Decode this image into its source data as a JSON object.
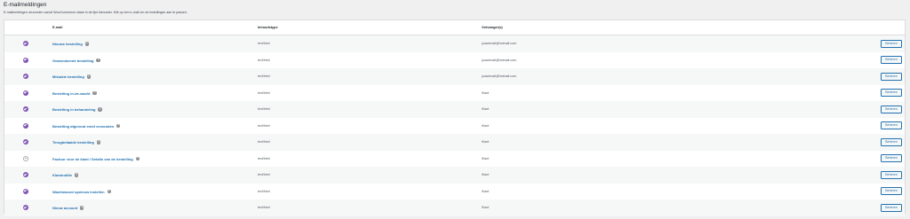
{
  "header": {
    "title": "E-mailmeldingen",
    "description": "E-mailmeldingen verzonden vanuit WooCommerce staan in de lijst hieronder. Klik op een e-mail om de instellingen aan te passen."
  },
  "table": {
    "columns": {
      "email": "E-mail",
      "content_type": "Inhoudstype",
      "recipients": "Ontvanger(s)"
    },
    "rows": [
      {
        "enabled": true,
        "name": "Nieuwe bestelling",
        "content_type": "text/html",
        "recipient": "jouwemail@hotmail.com",
        "action": "Beheren"
      },
      {
        "enabled": true,
        "name": "Geannuleerde bestelling",
        "content_type": "text/html",
        "recipient": "jouwemail@hotmail.com",
        "action": "Beheren"
      },
      {
        "enabled": true,
        "name": "Mislukte bestelling",
        "content_type": "text/html",
        "recipient": "jouwemail@hotmail.com",
        "action": "Beheren"
      },
      {
        "enabled": true,
        "name": "Bestelling in-de-wacht",
        "content_type": "text/html",
        "recipient": "Klant",
        "action": "Beheren"
      },
      {
        "enabled": true,
        "name": "Bestelling in behandeling",
        "content_type": "text/html",
        "recipient": "Klant",
        "action": "Beheren"
      },
      {
        "enabled": true,
        "name": "Bestelling afgerond en/of verzonden",
        "content_type": "text/html",
        "recipient": "Klant",
        "action": "Beheren"
      },
      {
        "enabled": true,
        "name": "Terugbetaalde bestelling",
        "content_type": "text/html",
        "recipient": "Klant",
        "action": "Beheren"
      },
      {
        "enabled": false,
        "name": "Factuur voor de klant / Details van de bestelling",
        "content_type": "text/html",
        "recipient": "Klant",
        "action": "Beheren"
      },
      {
        "enabled": true,
        "name": "Klantnotitie",
        "content_type": "text/html",
        "recipient": "Klant",
        "action": "Beheren"
      },
      {
        "enabled": true,
        "name": "Wachtwoord opnieuw instellen",
        "content_type": "text/html",
        "recipient": "Klant",
        "action": "Beheren"
      },
      {
        "enabled": true,
        "name": "Nieuw account",
        "content_type": "text/html",
        "recipient": "Klant",
        "action": "Beheren"
      }
    ]
  },
  "colors": {
    "accent": "#7f54b3",
    "link": "#2271b1",
    "background": "#f0f0f1"
  },
  "icons": {
    "status_enabled": "check-circle-icon",
    "status_disabled": "empty-circle-icon",
    "help": "help-icon"
  }
}
